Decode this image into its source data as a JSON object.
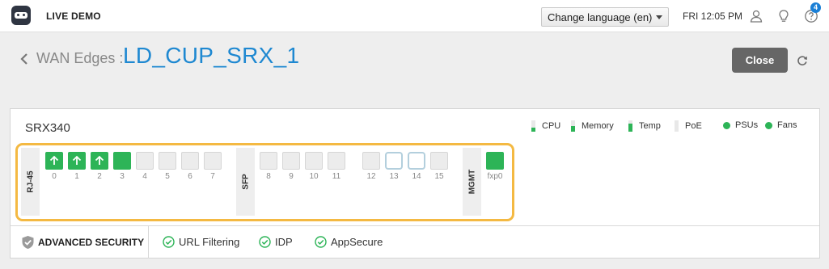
{
  "topbar": {
    "brand": "LIVE DEMO",
    "language_select": "Change language (en)",
    "clock": "FRI 12:05 PM",
    "help_badge": "4",
    "icons": [
      "robot-logo-icon",
      "user-icon",
      "lightbulb-icon",
      "help-icon"
    ]
  },
  "header": {
    "breadcrumb": "WAN Edges :",
    "title": "LD_CUP_SRX_1",
    "close_label": "Close"
  },
  "device": {
    "model": "SRX340",
    "legend": {
      "cpu": "CPU",
      "memory": "Memory",
      "temp": "Temp",
      "poe": "PoE",
      "psus": "PSUs",
      "fans": "Fans"
    },
    "groups": {
      "rj45": "RJ-45",
      "sfp": "SFP",
      "mgmt": "MGMT"
    },
    "rj45_ports": [
      {
        "label": "0",
        "state": "up-arrow"
      },
      {
        "label": "1",
        "state": "up-arrow"
      },
      {
        "label": "2",
        "state": "up-arrow"
      },
      {
        "label": "3",
        "state": "up"
      },
      {
        "label": "4",
        "state": "down"
      },
      {
        "label": "5",
        "state": "down"
      },
      {
        "label": "6",
        "state": "down"
      },
      {
        "label": "7",
        "state": "down"
      }
    ],
    "sfp_ports": [
      {
        "label": "8",
        "state": "down"
      },
      {
        "label": "9",
        "state": "down"
      },
      {
        "label": "10",
        "state": "down"
      },
      {
        "label": "11",
        "state": "down"
      },
      {
        "label": "12",
        "state": "down"
      },
      {
        "label": "13",
        "state": "outlined"
      },
      {
        "label": "14",
        "state": "outlined"
      },
      {
        "label": "15",
        "state": "down"
      }
    ],
    "mgmt_ports": [
      {
        "label": "fxp0",
        "state": "up"
      }
    ]
  },
  "security": {
    "title": "ADVANCED SECURITY",
    "features": [
      "URL Filtering",
      "IDP",
      "AppSecure"
    ]
  },
  "colors": {
    "accent_blue": "#1e88d1",
    "port_green": "#2db457",
    "highlight_orange": "#f4b942",
    "close_button": "#666666"
  }
}
